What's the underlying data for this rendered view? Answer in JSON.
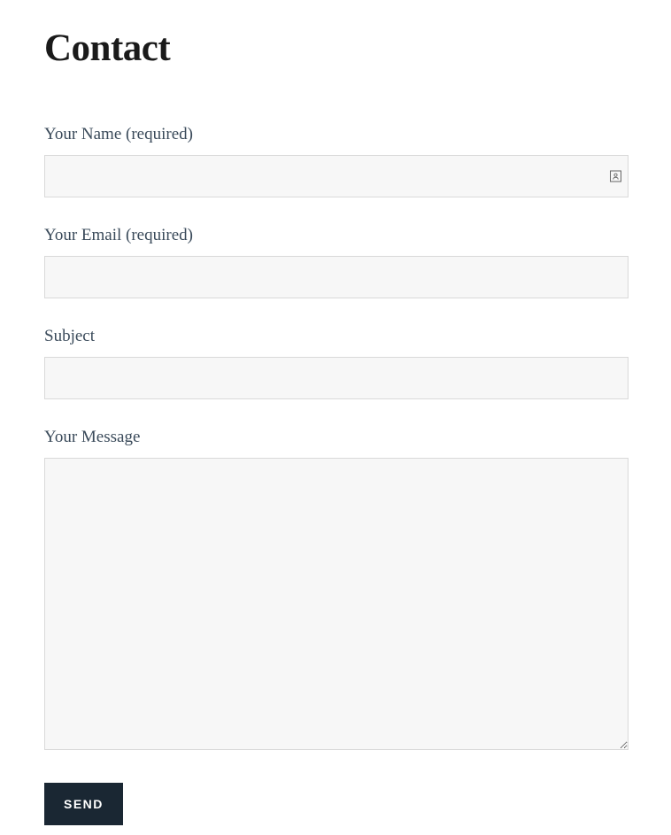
{
  "page": {
    "title": "Contact"
  },
  "form": {
    "name": {
      "label": "Your Name (required)",
      "value": ""
    },
    "email": {
      "label": "Your Email (required)",
      "value": ""
    },
    "subject": {
      "label": "Subject",
      "value": ""
    },
    "message": {
      "label": "Your Message",
      "value": ""
    },
    "submit": {
      "label": "SEND"
    }
  }
}
